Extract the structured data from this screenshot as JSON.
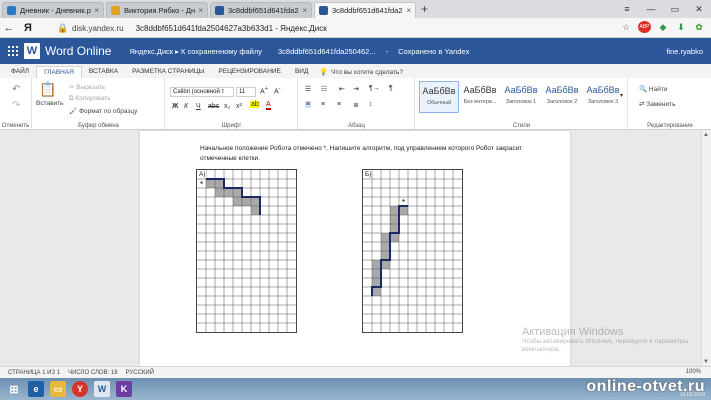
{
  "browser": {
    "tabs": [
      {
        "label": "Дневник - Дневник.ру",
        "favicon_color": "#2b78c5"
      },
      {
        "label": "Виктория Рябко - Дневник",
        "favicon_color": "#e2a323"
      },
      {
        "label": "3c8ddbf651d641fda250462",
        "favicon_color": "#2b579a"
      },
      {
        "label": "3c8ddbf651d641fda250462",
        "favicon_color": "#2b579a",
        "active": true
      }
    ],
    "new_tab": "+",
    "nav_back": "←",
    "ya_button": "Я",
    "url_host": "disk.yandex.ru",
    "url_title": "3c8ddbf651d641fda2504627a3b633d1 - Яндекс.Диск",
    "adblock_badge": "ABP"
  },
  "word": {
    "app_name": "Word Online",
    "breadcrumb": "Яндекс.Диск  ▸  К сохраненному файлу",
    "doc_name": "3c8ddbf651d641fda250462...",
    "separator": "-",
    "save_status": "Сохранено в Yandex",
    "user": "fine.ryabko",
    "accent": "#2b579a"
  },
  "ribbon_tabs": [
    "ФАЙЛ",
    "ГЛАВНАЯ",
    "ВСТАВКА",
    "РАЗМЕТКА СТРАНИЦЫ",
    "РЕЦЕНЗИРОВАНИЕ",
    "ВИД"
  ],
  "ribbon_active": "ГЛАВНАЯ",
  "tell_me": "Что вы хотите сделать?",
  "ribbon": {
    "undo_label": "Отменить",
    "paste_label": "Вставить",
    "cut_label": "Вырезать",
    "copy_label": "Копировать",
    "format_painter_label": "Формат по образцу",
    "clipboard_group": "Буфер обмена",
    "font_name": "Calibri (основной т",
    "font_size": "11",
    "font_group": "Шрифт",
    "paragraph_group": "Абзац",
    "styles": [
      {
        "sample": "АаБбВв",
        "name": "Обычный",
        "selected": true
      },
      {
        "sample": "АаБбВв",
        "name": "Без интерв..."
      },
      {
        "sample": "АаБбВв",
        "name": "Заголовок 1",
        "heading": true
      },
      {
        "sample": "АаБбВв",
        "name": "Заголовок 2",
        "heading": true
      },
      {
        "sample": "АаБбВв",
        "name": "Заголовок 3",
        "heading": true
      }
    ],
    "styles_group": "Стили",
    "find_label": "Найти",
    "replace_label": "Заменить",
    "editing_group": "Редактирование"
  },
  "document": {
    "task_text": "Начальное положение Робота отмечено *. Напишите алгоритм, под управлением которого Робот закрасит отмеченные клетки.",
    "grid_a": {
      "label": "А)",
      "cols": 11,
      "rows": 18,
      "start_marker": "*",
      "start_cell": [
        0,
        1
      ],
      "shaded_cells": [
        [
          1,
          1
        ],
        [
          2,
          1
        ],
        [
          2,
          2
        ],
        [
          3,
          2
        ],
        [
          4,
          2
        ],
        [
          4,
          3
        ],
        [
          5,
          3
        ],
        [
          6,
          3
        ],
        [
          6,
          4
        ]
      ],
      "wall_path": [
        [
          1,
          1
        ],
        [
          3,
          1
        ],
        [
          3,
          2
        ],
        [
          5,
          2
        ],
        [
          5,
          3
        ],
        [
          7,
          3
        ],
        [
          7,
          5
        ]
      ]
    },
    "grid_b": {
      "label": "Б)",
      "cols": 11,
      "rows": 18,
      "start_marker": "*",
      "start_cell": [
        4,
        3
      ],
      "shaded_cells": [
        [
          4,
          4
        ],
        [
          3,
          4
        ],
        [
          3,
          5
        ],
        [
          3,
          6
        ],
        [
          3,
          7
        ],
        [
          2,
          7
        ],
        [
          2,
          8
        ],
        [
          2,
          9
        ],
        [
          2,
          10
        ],
        [
          1,
          10
        ],
        [
          1,
          11
        ],
        [
          1,
          12
        ],
        [
          1,
          13
        ]
      ],
      "wall_path": [
        [
          5,
          4
        ],
        [
          4,
          4
        ],
        [
          4,
          7
        ],
        [
          3,
          7
        ],
        [
          3,
          10
        ],
        [
          2,
          10
        ],
        [
          2,
          13
        ],
        [
          1,
          13
        ],
        [
          1,
          14
        ]
      ]
    }
  },
  "watermark": {
    "title": "Активация Windows",
    "subtitle": "Чтобы активировать Windows, перейдите в параметры компьютера."
  },
  "statusbar": {
    "page": "СТРАНИЦА 1 ИЗ 1",
    "words": "ЧИСЛО СЛОВ: 18",
    "language": "РУССКИЙ",
    "zoom": "100%"
  },
  "taskbar": {
    "site_brand": "online-otvet.ru",
    "time": "16.03.2018"
  }
}
